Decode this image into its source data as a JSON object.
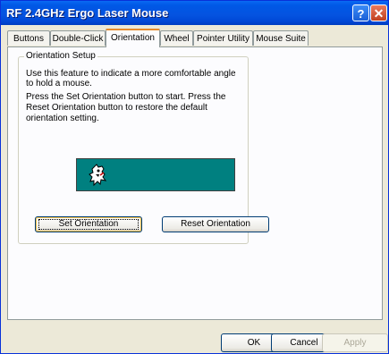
{
  "window": {
    "title": "RF 2.4GHz Ergo Laser Mouse",
    "help_glyph": "?",
    "close_glyph": "✕"
  },
  "tabs": [
    {
      "label": "Buttons"
    },
    {
      "label": "Double-Click"
    },
    {
      "label": "Orientation",
      "active": true
    },
    {
      "label": "Wheel"
    },
    {
      "label": "Pointer Utility"
    },
    {
      "label": "Mouse Suite"
    }
  ],
  "orientation_setup": {
    "group_title": "Orientation Setup",
    "description_1": "Use this feature to indicate a more comfortable angle to hold a mouse.",
    "description_2": "Press the Set Orientation button to start. Press the Reset Orientation button to restore the default orientation setting.",
    "preview_bg_color": "#008080",
    "preview_icon": "dog-mascot-icon",
    "set_button_label": "Set Orientation",
    "reset_button_label": "Reset Orientation"
  },
  "dialog_buttons": {
    "ok_label": "OK",
    "cancel_label": "Cancel",
    "apply_label": "Apply"
  },
  "colors": {
    "titlebar": "#0054E3",
    "face": "#ECE9D8",
    "tab_highlight": "#E68B2C"
  }
}
